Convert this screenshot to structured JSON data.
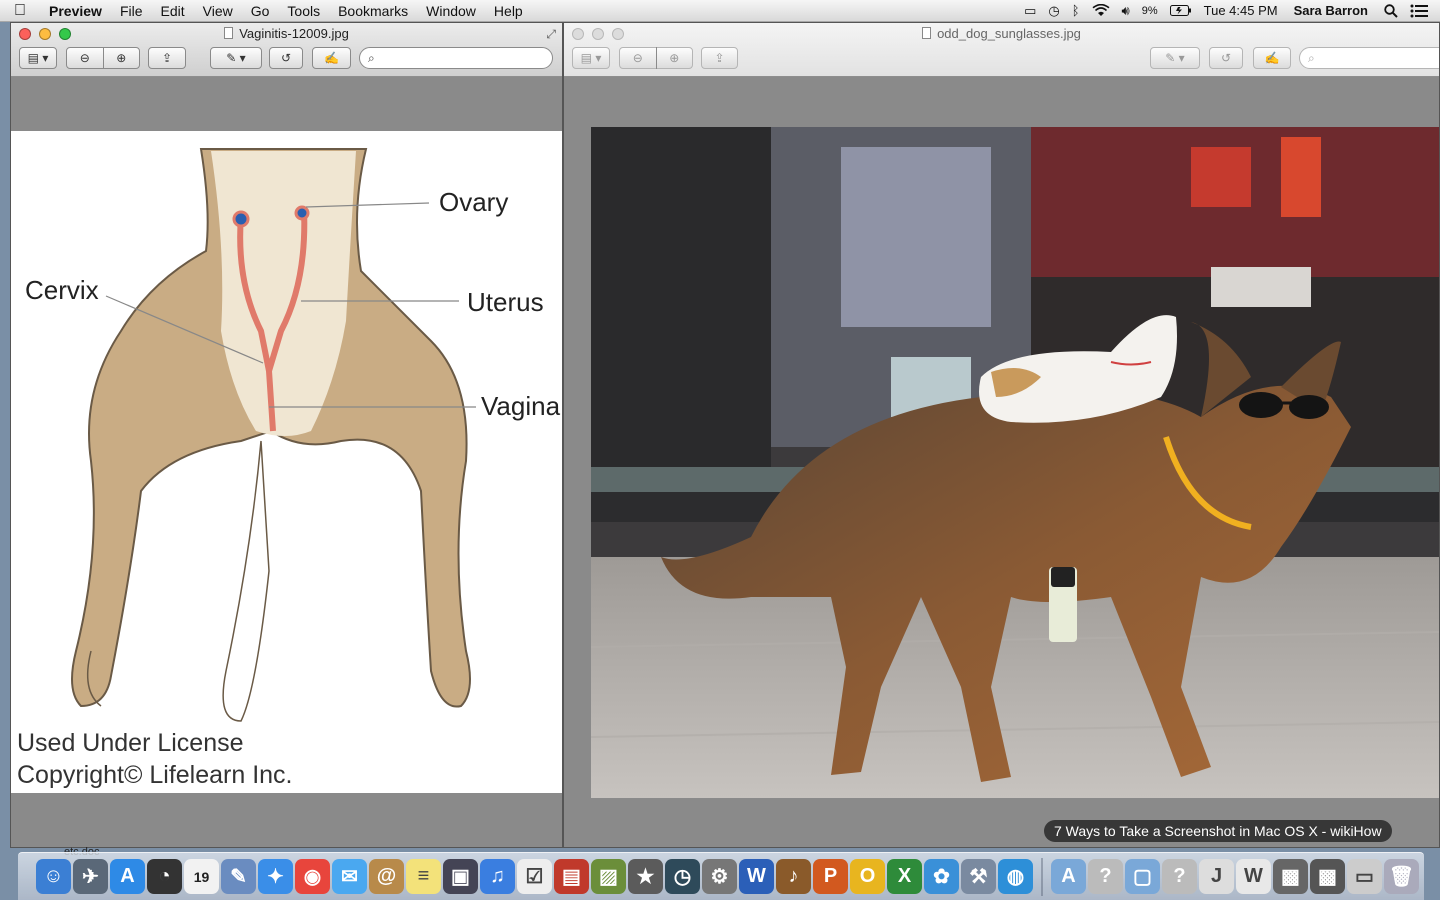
{
  "menubar": {
    "app": "Preview",
    "menus": [
      "File",
      "Edit",
      "View",
      "Go",
      "Tools",
      "Bookmarks",
      "Window",
      "Help"
    ],
    "battery": "9%",
    "clock": "Tue 4:45 PM",
    "user": "Sara Barron"
  },
  "window_left": {
    "title": "Vaginitis-12009.jpg",
    "image": {
      "labels": {
        "ovary": "Ovary",
        "cervix": "Cervix",
        "uterus": "Uterus",
        "vagina": "Vagina"
      },
      "license_line1": "Used Under License",
      "license_line2": "Copyright© Lifelearn Inc."
    }
  },
  "window_right": {
    "title": "odd_dog_sunglasses.jpg"
  },
  "dock": {
    "folder_label": "etc.doc",
    "tooltip": "7 Ways to Take a Screenshot in Mac OS X - wikiHow",
    "calendar_day": "19",
    "icons": [
      {
        "name": "finder-icon",
        "color": "#3b7fd4",
        "glyph": "☺"
      },
      {
        "name": "launchpad-icon",
        "color": "#5a6878",
        "glyph": "✈"
      },
      {
        "name": "app-store-icon",
        "color": "#2e8ae6",
        "glyph": "A"
      },
      {
        "name": "dashboard-icon",
        "color": "#333",
        "glyph": "◔"
      },
      {
        "name": "calendar-icon",
        "color": "#f2f2f2",
        "glyph": ""
      },
      {
        "name": "preview-icon",
        "color": "#6a8cc0",
        "glyph": "✎"
      },
      {
        "name": "safari-icon",
        "color": "#3a8ee8",
        "glyph": "✦"
      },
      {
        "name": "chrome-icon",
        "color": "#e8453c",
        "glyph": "◉"
      },
      {
        "name": "messages-icon",
        "color": "#4aa8f0",
        "glyph": "✉"
      },
      {
        "name": "contacts-icon",
        "color": "#b88a4a",
        "glyph": "@"
      },
      {
        "name": "notes-icon",
        "color": "#f3e27a",
        "glyph": "≡"
      },
      {
        "name": "photo-booth-icon",
        "color": "#445",
        "glyph": "▣"
      },
      {
        "name": "itunes-icon",
        "color": "#3a7ee0",
        "glyph": "♫"
      },
      {
        "name": "reminders-icon",
        "color": "#eee",
        "glyph": "☑"
      },
      {
        "name": "photo-icon",
        "color": "#c0392b",
        "glyph": "▤"
      },
      {
        "name": "iphoto-icon",
        "color": "#6b8e3a",
        "glyph": "▨"
      },
      {
        "name": "imovie-icon",
        "color": "#5b5b5b",
        "glyph": "★"
      },
      {
        "name": "time-machine-icon",
        "color": "#2e4a5a",
        "glyph": "◷"
      },
      {
        "name": "system-preferences-icon",
        "color": "#777",
        "glyph": "⚙"
      },
      {
        "name": "word-icon",
        "color": "#2b5fb8",
        "glyph": "W"
      },
      {
        "name": "garageband-icon",
        "color": "#8a5a2a",
        "glyph": "♪"
      },
      {
        "name": "powerpoint-icon",
        "color": "#d2591f",
        "glyph": "P"
      },
      {
        "name": "outlook-icon",
        "color": "#e8b51f",
        "glyph": "O"
      },
      {
        "name": "excel-icon",
        "color": "#2e8b3a",
        "glyph": "X"
      },
      {
        "name": "messenger-icon",
        "color": "#3a90d8",
        "glyph": "✿"
      },
      {
        "name": "utility-icon",
        "color": "#7a8aa0",
        "glyph": "⚒"
      },
      {
        "name": "network-icon",
        "color": "#2d8fd8",
        "glyph": "◍"
      }
    ],
    "right_icons": [
      {
        "name": "applications-folder-icon",
        "color": "#7aa8d8",
        "glyph": "A"
      },
      {
        "name": "unknown-app-icon",
        "color": "#bbb",
        "glyph": "?"
      },
      {
        "name": "documents-folder-icon",
        "color": "#7aa8d8",
        "glyph": "▢"
      },
      {
        "name": "unknown-app-2-icon",
        "color": "#bbb",
        "glyph": "?"
      },
      {
        "name": "jpeg-file-icon",
        "color": "#ddd",
        "glyph": "J"
      },
      {
        "name": "doc-file-icon",
        "color": "#e8e8e8",
        "glyph": "W"
      },
      {
        "name": "screenshot-1-icon",
        "color": "#666",
        "glyph": "▩"
      },
      {
        "name": "screenshot-2-icon",
        "color": "#555",
        "glyph": "▩"
      },
      {
        "name": "screenshot-3-icon",
        "color": "#ccc",
        "glyph": "▭"
      },
      {
        "name": "trash-icon",
        "color": "#aab",
        "glyph": "🗑"
      }
    ]
  }
}
